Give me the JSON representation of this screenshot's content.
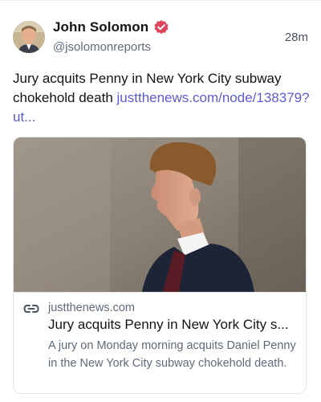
{
  "author": {
    "display_name": "John Solomon",
    "handle": "@jsolomonreports",
    "verified": true,
    "badge_color": "#e0455c",
    "avatar_icon": "avatar-photo"
  },
  "timestamp": "28m",
  "post": {
    "text": "Jury acquits Penny in New York City subway chokehold death",
    "link_text": "justthenews.com/node/138379?ut...",
    "link_color": "#5b5bd6"
  },
  "card": {
    "image_alt": "Daniel Penny in profile wearing a navy suit",
    "link_icon": "link-icon",
    "domain": "justthenews.com",
    "title": "Jury acquits Penny in New York City s...",
    "description": "A jury on Monday morning acquits Daniel Penny in the New York City subway chokehold death."
  }
}
